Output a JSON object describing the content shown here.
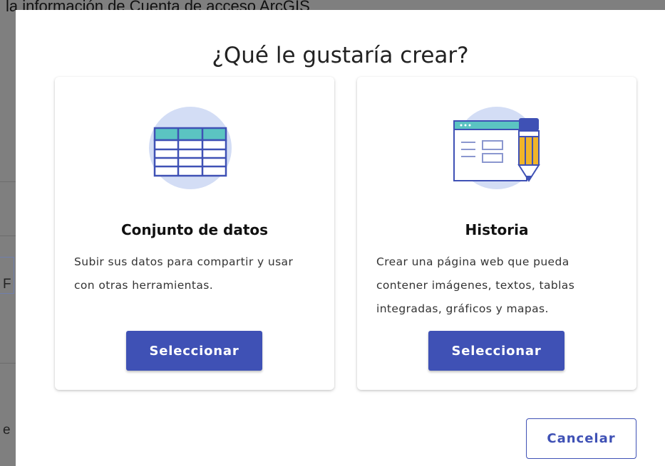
{
  "background": {
    "top_text": "la información de Cuenta de acceso ArcGIS",
    "side_char_1": "F",
    "side_char_2": "e"
  },
  "dialog": {
    "title": "¿Qué le gustaría crear?",
    "options": [
      {
        "title": "Conjunto de datos",
        "description": "Subir sus datos para compartir y usar con otras herramientas.",
        "button_label": "Seleccionar",
        "icon": "table-icon"
      },
      {
        "title": "Historia",
        "description": "Crear una página web que pueda contener imágenes, textos, tablas integradas, gráficos y mapas.",
        "button_label": "Seleccionar",
        "icon": "story-pencil-icon"
      }
    ],
    "cancel_label": "Cancelar"
  },
  "colors": {
    "primary": "#3f51b5",
    "illustration_circle": "#d3ddf5",
    "illustration_accent": "#5bc4c2",
    "illustration_pencil": "#f0b429"
  }
}
